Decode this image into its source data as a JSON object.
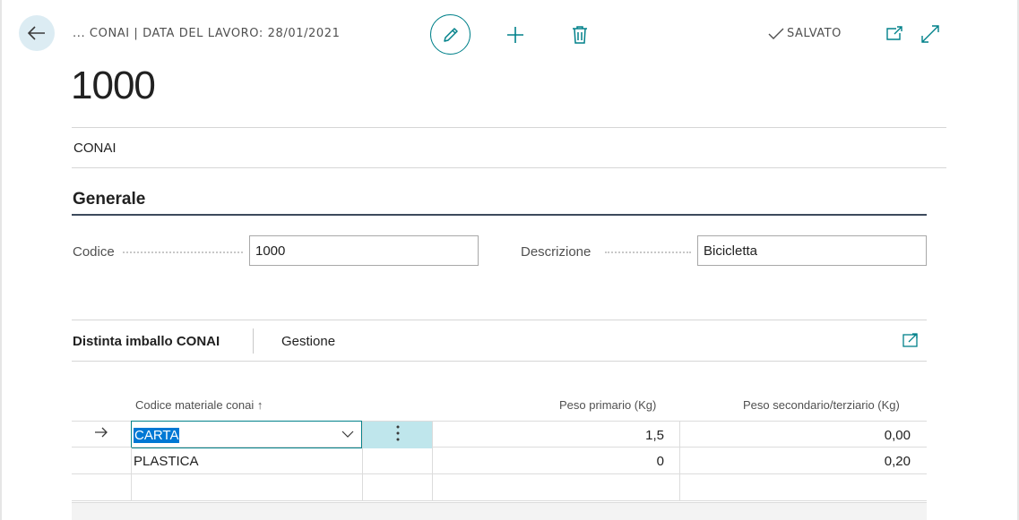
{
  "header": {
    "breadcrumb": "... CONAI | DATA DEL LAVORO: 28/01/2021",
    "saved_status": "SALVATO"
  },
  "record": {
    "title": "1000",
    "subtitle": "CONAI"
  },
  "general": {
    "section_title": "Generale",
    "codice_label": "Codice",
    "codice_value": "1000",
    "descrizione_label": "Descrizione",
    "descrizione_value": "Bicicletta"
  },
  "part": {
    "title": "Distinta imballo CONAI",
    "action": "Gestione",
    "columns": {
      "material": "Codice materiale conai",
      "sort_indicator": "↑",
      "primary": "Peso primario (Kg)",
      "secondary": "Peso secondario/terziario (Kg)"
    },
    "rows": [
      {
        "material": "CARTA",
        "primary": "1,5",
        "secondary": "0,00"
      },
      {
        "material": "PLASTICA",
        "primary": "0",
        "secondary": "0,20"
      }
    ]
  },
  "colors": {
    "accent": "#00818a",
    "selection": "#0078d4",
    "selected_cell": "#bfe6ec"
  },
  "icons": [
    "back-arrow-icon",
    "pencil-icon",
    "plus-icon",
    "trash-icon",
    "check-icon",
    "popout-icon",
    "expand-icon",
    "row-arrow-icon",
    "chevron-down-icon",
    "ellipsis-vertical-icon"
  ]
}
